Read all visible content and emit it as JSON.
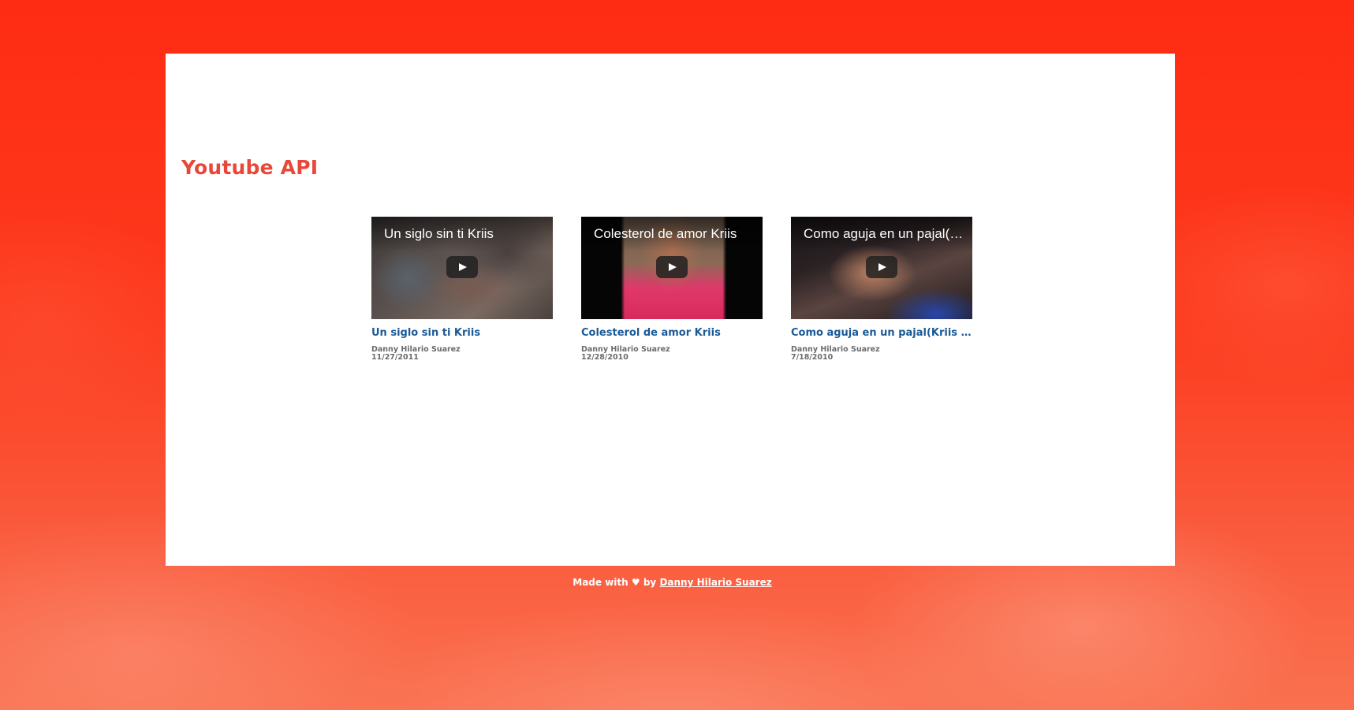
{
  "page": {
    "title": "Youtube API"
  },
  "videos": [
    {
      "thumb_title": "Un siglo sin ti Kriis",
      "title": "Un siglo sin ti Kriis",
      "author": "Danny Hilario Suarez",
      "date": "11/27/2011"
    },
    {
      "thumb_title": "Colesterol de amor Kriis",
      "title": "Colesterol de amor Kriis",
      "author": "Danny Hilario Suarez",
      "date": "12/28/2010"
    },
    {
      "thumb_title": "Como aguja en un pajal(Kriis Sanchez)",
      "title": "Como aguja en un pajal(Kriis Sanchez)",
      "author": "Danny Hilario Suarez",
      "date": "7/18/2010"
    }
  ],
  "footer": {
    "made_with": "Made with",
    "heart": "♥",
    "by": "by",
    "author_link": "Danny Hilario Suarez"
  },
  "colors": {
    "background": "#fe2c12",
    "title": "#e8473a",
    "video_link": "#1a5a96",
    "meta_text": "#6b6b6b"
  },
  "icons": {
    "play": "play-icon",
    "heart": "heart-icon"
  }
}
